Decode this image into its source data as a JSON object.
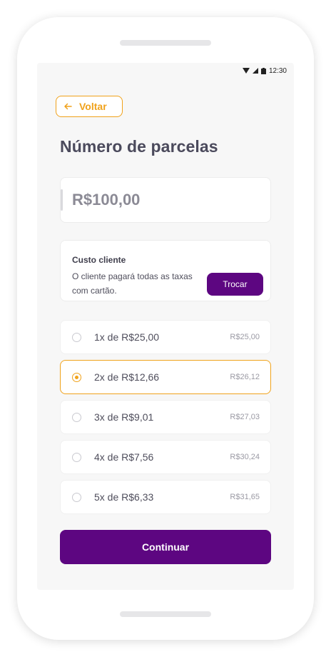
{
  "status_bar": {
    "time": "12:30"
  },
  "back_button": {
    "label": "Voltar"
  },
  "page": {
    "title": "Número de parcelas"
  },
  "amount": {
    "value": "R$100,00"
  },
  "cost_card": {
    "title": "Custo cliente",
    "description": "O cliente pagará todas as taxas com cartão.",
    "swap_label": "Trocar"
  },
  "installments": [
    {
      "label": "1x de R$25,00",
      "total": "R$25,00",
      "selected": false
    },
    {
      "label": "2x de R$12,66",
      "total": "R$26,12",
      "selected": true
    },
    {
      "label": "3x de R$9,01",
      "total": "R$27,03",
      "selected": false
    },
    {
      "label": "4x de R$7,56",
      "total": "R$30,24",
      "selected": false
    },
    {
      "label": "5x de R$6,33",
      "total": "R$31,65",
      "selected": false
    }
  ],
  "continue_button": {
    "label": "Continuar"
  },
  "colors": {
    "accent_orange": "#f0a21b",
    "primary_purple": "#5d0681"
  }
}
